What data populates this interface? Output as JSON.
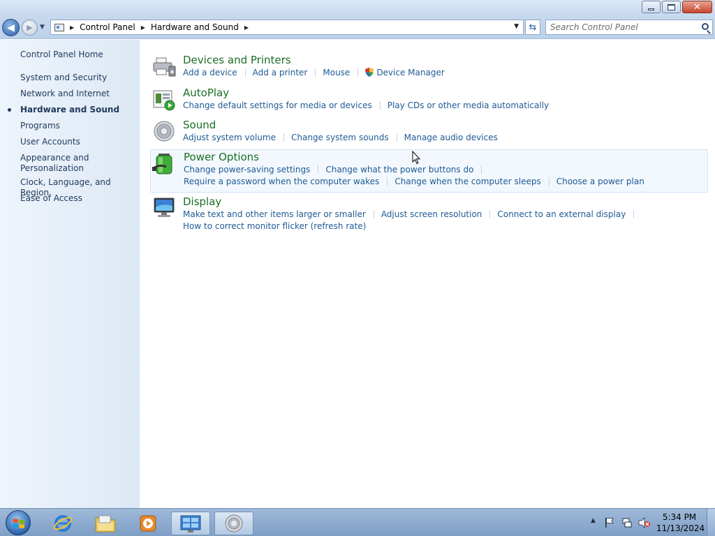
{
  "window": {
    "minimize_label": "minimize",
    "maximize_label": "restore",
    "close_label": "close"
  },
  "address_bar": {
    "breadcrumbs": [
      "Control Panel",
      "Hardware and Sound"
    ],
    "search_placeholder": "Search Control Panel"
  },
  "sidebar": {
    "home": "Control Panel Home",
    "items": [
      {
        "label": "System and Security"
      },
      {
        "label": "Network and Internet"
      },
      {
        "label": "Hardware and Sound",
        "selected": true
      },
      {
        "label": "Programs"
      },
      {
        "label": "User Accounts"
      },
      {
        "label": "Appearance and"
      },
      {
        "label": "Personalization"
      },
      {
        "label": "Clock, Language, and Region"
      },
      {
        "label": "Ease of Access"
      }
    ]
  },
  "categories": [
    {
      "title": "Devices and Printers",
      "icon": "printer-icon",
      "links": [
        "Add a device",
        "Add a printer",
        "Mouse",
        "Device Manager"
      ]
    },
    {
      "title": "AutoPlay",
      "icon": "autoplay-icon",
      "links": [
        "Change default settings for media or devices",
        "Play CDs or other media automatically"
      ]
    },
    {
      "title": "Sound",
      "icon": "speaker-icon",
      "links": [
        "Adjust system volume",
        "Change system sounds",
        "Manage audio devices"
      ]
    },
    {
      "title": "Power Options",
      "icon": "battery-icon",
      "links": [
        "Change power-saving settings",
        "Change what the power buttons do",
        "Require a password when the computer wakes",
        "Change when the computer sleeps",
        "Choose a power plan"
      ]
    },
    {
      "title": "Display",
      "icon": "monitor-icon",
      "links": [
        "Make text and other items larger or smaller",
        "Adjust screen resolution",
        "Connect to an external display",
        "How to correct monitor flicker (refresh rate)"
      ]
    }
  ],
  "taskbar": {
    "time": "5:34 PM",
    "date": "11/13/2024"
  },
  "colors": {
    "category_title": "#1b6e24",
    "link": "#1e5a94",
    "sidebar_text": "#1e395b"
  }
}
